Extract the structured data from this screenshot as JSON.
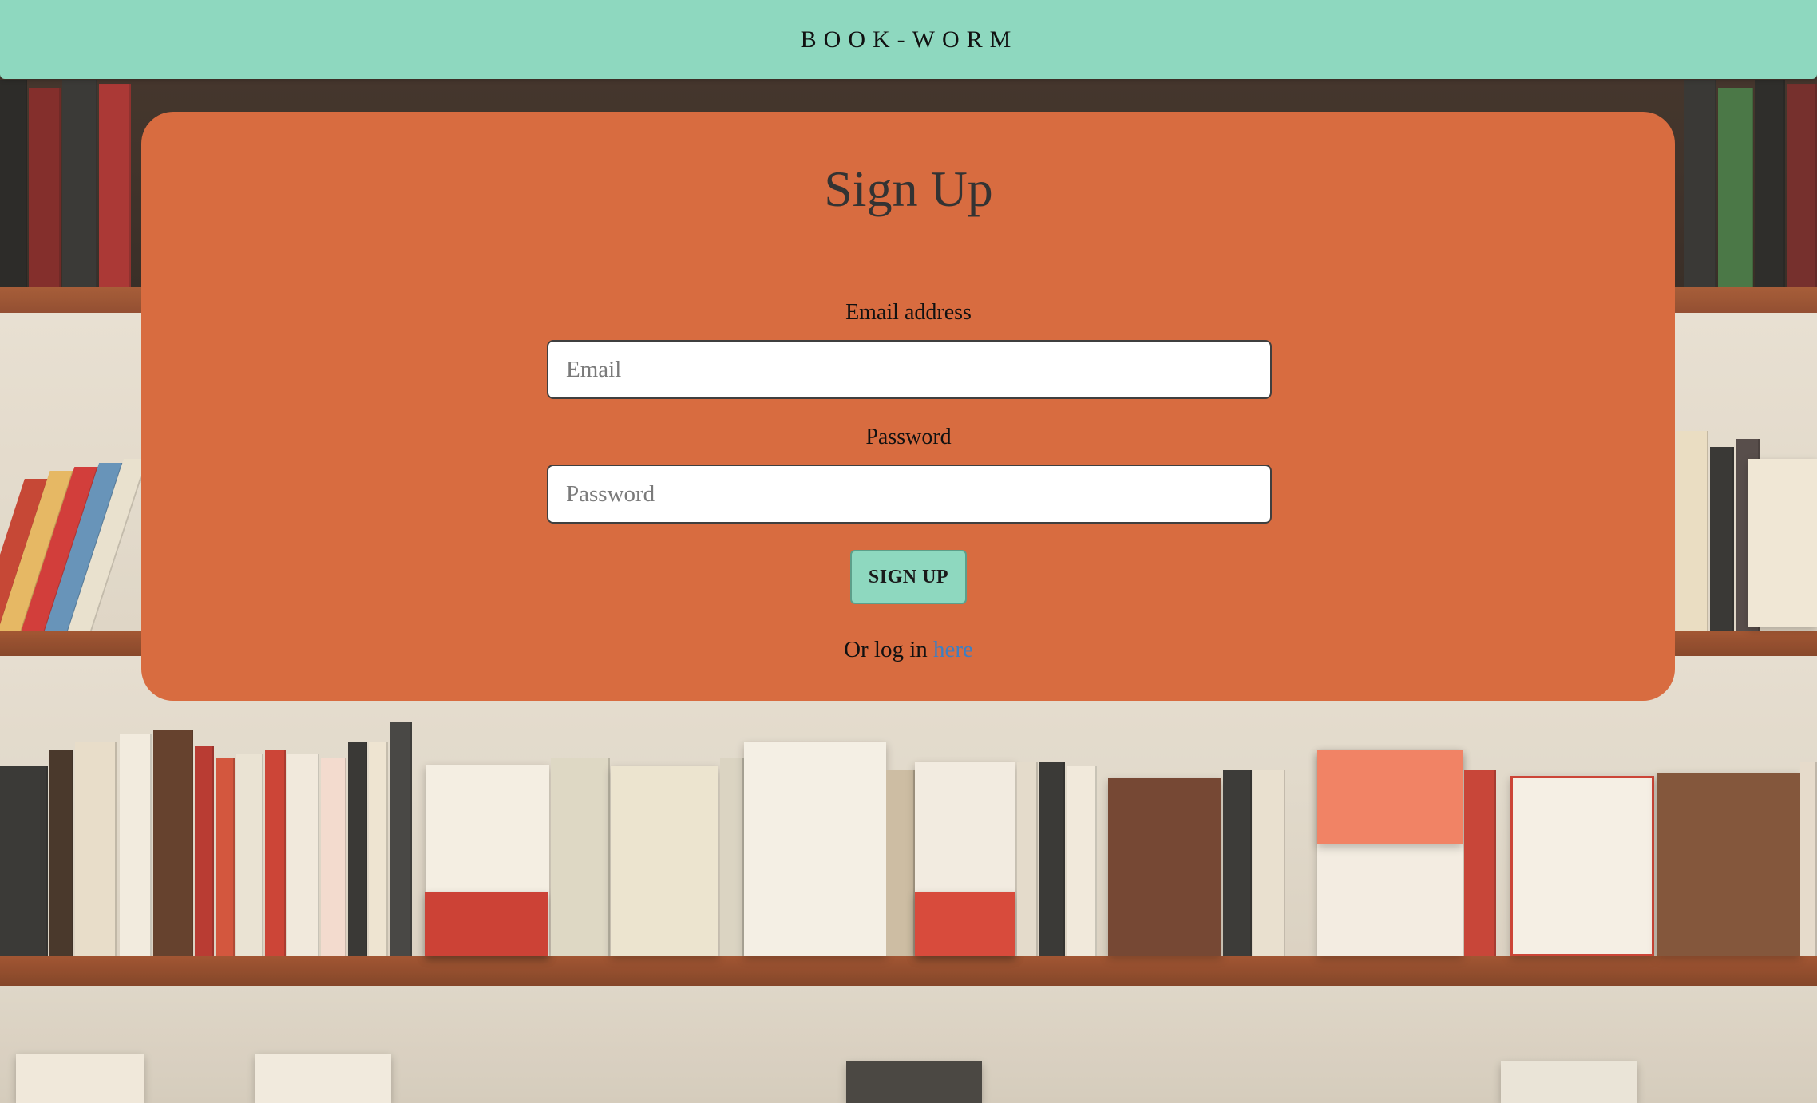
{
  "navbar": {
    "brand": "BOOK-WORM",
    "background_color": "#8ed8bf"
  },
  "signup_card": {
    "title": "Sign Up",
    "background_color": "#d86c40",
    "email": {
      "label": "Email address",
      "placeholder": "Email",
      "value": ""
    },
    "password": {
      "label": "Password",
      "placeholder": "Password",
      "value": ""
    },
    "submit": {
      "label": "SIGN UP",
      "background_color": "#8ed8bf"
    },
    "login_prompt": {
      "prefix": "Or log in ",
      "link_text": "here",
      "link_color": "#3d7fc2"
    }
  },
  "background": {
    "description_icon": "bookshelf-photo"
  }
}
